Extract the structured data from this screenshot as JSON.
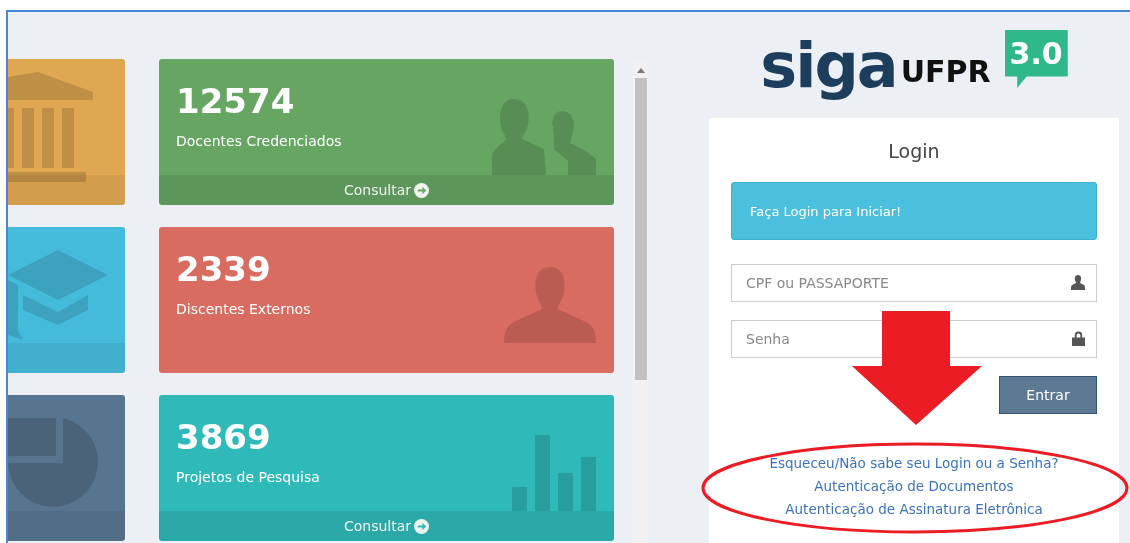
{
  "logo": {
    "name": "siga",
    "org": "UFPR",
    "version": "3.0"
  },
  "tiles": [
    {
      "kind": "bank",
      "color": "#e0a752"
    },
    {
      "kind": "graduation",
      "color": "#45bbdb"
    },
    {
      "kind": "pie",
      "color": "#58758f"
    }
  ],
  "cards": [
    {
      "value": "12574",
      "label": "Docentes Credenciados",
      "footer": "Consultar",
      "kind": "users",
      "color": "#67a563"
    },
    {
      "value": "2339",
      "label": "Discentes Externos",
      "kind": "user",
      "color": "#d96c60"
    },
    {
      "value": "3869",
      "label": "Projetos de Pesquisa",
      "footer": "Consultar",
      "kind": "bars",
      "color": "#2fbab9"
    }
  ],
  "login": {
    "title": "Login",
    "alert": "Faça Login para Iniciar!",
    "fields": [
      {
        "placeholder": "CPF ou PASSAPORTE",
        "kind": "user"
      },
      {
        "placeholder": "Senha",
        "kind": "lock"
      }
    ],
    "button": "Entrar",
    "links": [
      "Esqueceu/Não sabe seu Login ou a Senha?",
      "Autenticação de Documentos",
      "Autenticação de Assinatura Eletrônica"
    ]
  }
}
